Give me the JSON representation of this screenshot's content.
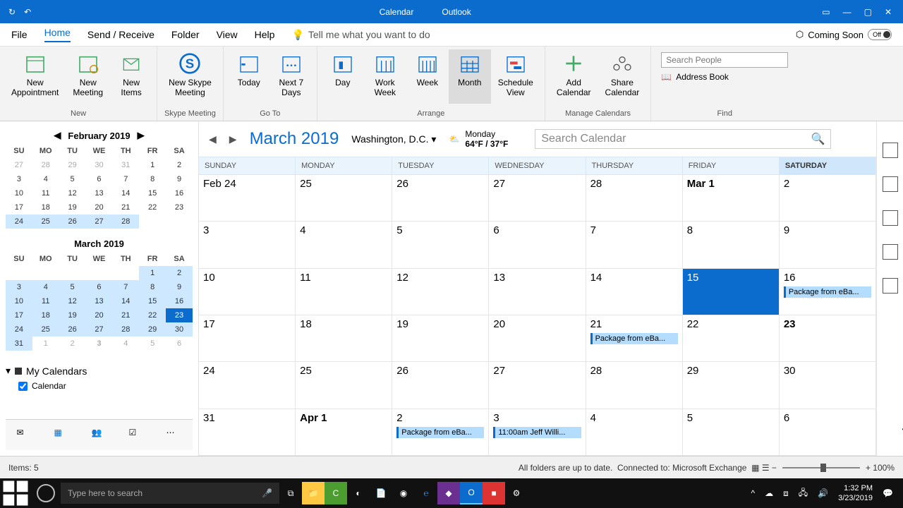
{
  "titlebar": {
    "app": "Calendar",
    "brand": "Outlook"
  },
  "menu": {
    "file": "File",
    "home": "Home",
    "sendrecv": "Send / Receive",
    "folder": "Folder",
    "view": "View",
    "help": "Help",
    "tellme": "Tell me what you want to do",
    "comingsoon": "Coming Soon",
    "toggle_off": "Off"
  },
  "ribbon": {
    "new_appt": "New\nAppointment",
    "new_meet": "New\nMeeting",
    "new_items": "New\nItems",
    "skype": "New Skype\nMeeting",
    "today": "Today",
    "next7": "Next 7\nDays",
    "day": "Day",
    "workweek": "Work\nWeek",
    "week": "Week",
    "month": "Month",
    "schedview": "Schedule\nView",
    "addcal": "Add\nCalendar",
    "sharecal": "Share\nCalendar",
    "searchppl_ph": "Search People",
    "addrbook": "Address Book",
    "grp_new": "New",
    "grp_skype": "Skype Meeting",
    "grp_goto": "Go To",
    "grp_arrange": "Arrange",
    "grp_manage": "Manage Calendars",
    "grp_find": "Find"
  },
  "minical1": {
    "title": "February 2019",
    "dow": [
      "SU",
      "MO",
      "TU",
      "WE",
      "TH",
      "FR",
      "SA"
    ],
    "weeks": [
      [
        {
          "d": "27",
          "dim": true
        },
        {
          "d": "28",
          "dim": true
        },
        {
          "d": "29",
          "dim": true
        },
        {
          "d": "30",
          "dim": true
        },
        {
          "d": "31",
          "dim": true
        },
        {
          "d": "1"
        },
        {
          "d": "2"
        }
      ],
      [
        {
          "d": "3"
        },
        {
          "d": "4"
        },
        {
          "d": "5"
        },
        {
          "d": "6"
        },
        {
          "d": "7"
        },
        {
          "d": "8"
        },
        {
          "d": "9"
        }
      ],
      [
        {
          "d": "10"
        },
        {
          "d": "11"
        },
        {
          "d": "12"
        },
        {
          "d": "13"
        },
        {
          "d": "14"
        },
        {
          "d": "15"
        },
        {
          "d": "16"
        }
      ],
      [
        {
          "d": "17"
        },
        {
          "d": "18"
        },
        {
          "d": "19"
        },
        {
          "d": "20"
        },
        {
          "d": "21"
        },
        {
          "d": "22"
        },
        {
          "d": "23"
        }
      ],
      [
        {
          "d": "24",
          "hl": true
        },
        {
          "d": "25",
          "hl": true
        },
        {
          "d": "26",
          "hl": true
        },
        {
          "d": "27",
          "hl": true
        },
        {
          "d": "28",
          "hl": true
        },
        {
          "d": ""
        },
        {
          "d": ""
        }
      ]
    ]
  },
  "minical2": {
    "title": "March 2019",
    "dow": [
      "SU",
      "MO",
      "TU",
      "WE",
      "TH",
      "FR",
      "SA"
    ],
    "weeks": [
      [
        {
          "d": ""
        },
        {
          "d": ""
        },
        {
          "d": ""
        },
        {
          "d": ""
        },
        {
          "d": ""
        },
        {
          "d": "1",
          "hl": true
        },
        {
          "d": "2",
          "hl": true
        }
      ],
      [
        {
          "d": "3",
          "hl": true
        },
        {
          "d": "4",
          "hl": true
        },
        {
          "d": "5",
          "hl": true
        },
        {
          "d": "6",
          "hl": true
        },
        {
          "d": "7",
          "hl": true
        },
        {
          "d": "8",
          "hl": true
        },
        {
          "d": "9",
          "hl": true
        }
      ],
      [
        {
          "d": "10",
          "hl": true
        },
        {
          "d": "11",
          "hl": true
        },
        {
          "d": "12",
          "hl": true
        },
        {
          "d": "13",
          "hl": true
        },
        {
          "d": "14",
          "hl": true
        },
        {
          "d": "15",
          "hl": true
        },
        {
          "d": "16",
          "hl": true
        }
      ],
      [
        {
          "d": "17",
          "hl": true
        },
        {
          "d": "18",
          "hl": true
        },
        {
          "d": "19",
          "hl": true
        },
        {
          "d": "20",
          "hl": true
        },
        {
          "d": "21",
          "hl": true
        },
        {
          "d": "22",
          "hl": true
        },
        {
          "d": "23",
          "sel": true
        }
      ],
      [
        {
          "d": "24",
          "hl": true
        },
        {
          "d": "25",
          "hl": true
        },
        {
          "d": "26",
          "hl": true
        },
        {
          "d": "27",
          "hl": true
        },
        {
          "d": "28",
          "hl": true
        },
        {
          "d": "29",
          "hl": true
        },
        {
          "d": "30",
          "hl": true
        }
      ],
      [
        {
          "d": "31",
          "hl": true
        },
        {
          "d": "1",
          "dim": true
        },
        {
          "d": "2",
          "dim": true
        },
        {
          "d": "3",
          "dim": true,
          "bold": true
        },
        {
          "d": "4",
          "dim": true
        },
        {
          "d": "5",
          "dim": true
        },
        {
          "d": "6",
          "dim": true
        }
      ]
    ]
  },
  "mycals": {
    "header": "My Calendars",
    "items": [
      {
        "label": "Calendar",
        "checked": true
      }
    ]
  },
  "calhdr": {
    "month": "March 2019",
    "location": "Washington,  D.C.",
    "weather_day": "Monday",
    "weather_temp": "64°F / 37°F",
    "search_ph": "Search Calendar"
  },
  "dayheaders": [
    "SUNDAY",
    "MONDAY",
    "TUESDAY",
    "WEDNESDAY",
    "THURSDAY",
    "FRIDAY",
    "SATURDAY"
  ],
  "today_idx": 6,
  "grid": [
    [
      {
        "n": "Feb 24"
      },
      {
        "n": "25"
      },
      {
        "n": "26"
      },
      {
        "n": "27"
      },
      {
        "n": "28"
      },
      {
        "n": "Mar 1",
        "bold": true
      },
      {
        "n": "2"
      }
    ],
    [
      {
        "n": "3"
      },
      {
        "n": "4"
      },
      {
        "n": "5"
      },
      {
        "n": "6"
      },
      {
        "n": "7"
      },
      {
        "n": "8"
      },
      {
        "n": "9"
      }
    ],
    [
      {
        "n": "10"
      },
      {
        "n": "11"
      },
      {
        "n": "12"
      },
      {
        "n": "13"
      },
      {
        "n": "14"
      },
      {
        "n": "15",
        "sel": true
      },
      {
        "n": "16",
        "ev": "Package from eBa..."
      }
    ],
    [
      {
        "n": "17"
      },
      {
        "n": "18"
      },
      {
        "n": "19"
      },
      {
        "n": "20"
      },
      {
        "n": "21",
        "ev": "Package from eBa..."
      },
      {
        "n": "22"
      },
      {
        "n": "23",
        "bold": true
      }
    ],
    [
      {
        "n": "24"
      },
      {
        "n": "25"
      },
      {
        "n": "26"
      },
      {
        "n": "27"
      },
      {
        "n": "28"
      },
      {
        "n": "29"
      },
      {
        "n": "30"
      }
    ],
    [
      {
        "n": "31"
      },
      {
        "n": "Apr 1",
        "bold": true
      },
      {
        "n": "2",
        "ev": "Package from eBa..."
      },
      {
        "n": "3",
        "ev": "11:00am Jeff Willi..."
      },
      {
        "n": "4"
      },
      {
        "n": "5"
      },
      {
        "n": "6"
      }
    ]
  ],
  "statusbar": {
    "items": "Items: 5",
    "folders": "All folders are up to date.",
    "conn": "Connected to: Microsoft Exchange",
    "zoom": "100%"
  },
  "taskbar": {
    "search_ph": "Type here to search",
    "time": "1:32 PM",
    "date": "3/23/2019"
  }
}
